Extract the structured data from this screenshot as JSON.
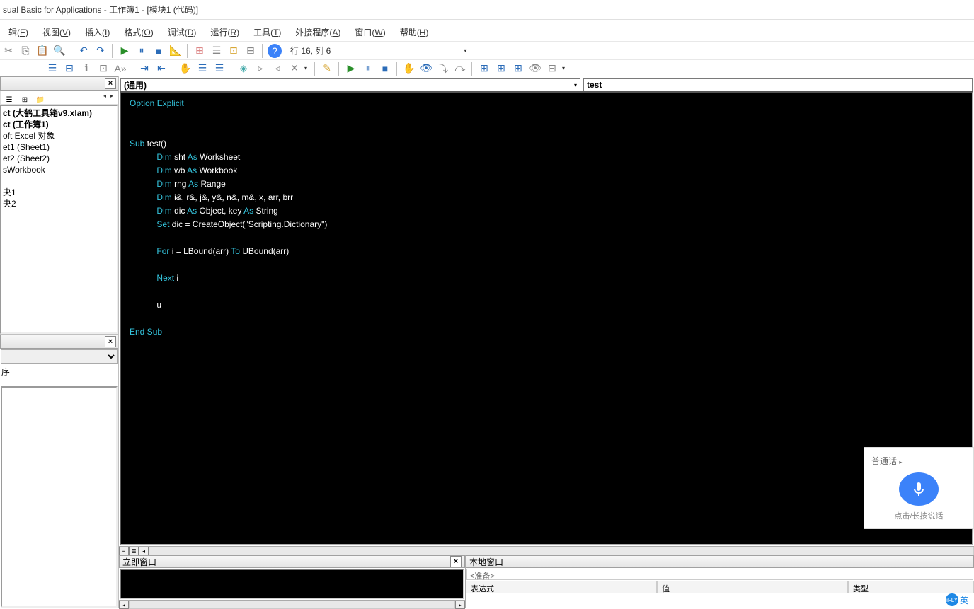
{
  "title": "sual Basic for Applications - 工作簿1 - [模块1 (代码)]",
  "menus": {
    "edit": {
      "label": "辑(E)",
      "key": "E"
    },
    "view": {
      "label": "视图(V)",
      "key": "V"
    },
    "insert": {
      "label": "插入(I)",
      "key": "I"
    },
    "format": {
      "label": "格式(O)",
      "key": "O"
    },
    "debug": {
      "label": "调试(D)",
      "key": "D"
    },
    "run": {
      "label": "运行(R)",
      "key": "R"
    },
    "tools": {
      "label": "工具(T)",
      "key": "T"
    },
    "addins": {
      "label": "外接程序(A)",
      "key": "A"
    },
    "window": {
      "label": "窗口(W)",
      "key": "W"
    },
    "help": {
      "label": "帮助(H)",
      "key": "H"
    }
  },
  "position_text": "行 16, 列 6",
  "project_tree": {
    "line1": "ct (大鹤工具箱v9.xlam)",
    "line2": "ct (工作簿1)",
    "line3": "oft Excel 对象",
    "line4": "et1 (Sheet1)",
    "line5": "et2 (Sheet2)",
    "line6": "sWorkbook",
    "line7": "夬1",
    "line8": "夬2"
  },
  "proc_title": "序",
  "dropdowns": {
    "object": "(通用)",
    "proc": "test"
  },
  "code_line_option": "Option Explicit",
  "code_sub": "Sub ",
  "code_test": "test",
  "code_paren": "()",
  "code_dim": "Dim ",
  "code_sht": "sht ",
  "code_as": "As ",
  "code_worksheet": "Worksheet",
  "code_wb": "wb ",
  "code_workbook": "Workbook",
  "code_rng": "rng ",
  "code_range": "Range",
  "code_vars": "i&, r&, j&, y&, n&, m&, x, arr, brr",
  "code_dic": "dic ",
  "code_object": "Object",
  "code_comma": ", ",
  "code_key": "key ",
  "code_string": "String",
  "code_set": "Set ",
  "code_dic2": "dic = ",
  "code_createobj": "CreateObject",
  "code_strlit": "(\"Scripting.Dictionary\")",
  "code_for": "For ",
  "code_i": "i = ",
  "code_lbound": "LBound",
  "code_arr1": "(arr) ",
  "code_to": "To ",
  "code_ubound": "UBound",
  "code_arr2": "(arr)",
  "code_next": "Next ",
  "code_ivar": "i",
  "code_u": "u",
  "code_endsub": "End Sub",
  "bottom": {
    "immediate_title": "立即窗口",
    "locals_title": "本地窗口",
    "ready": "<准备>",
    "col_expr": "表达式",
    "col_value": "值",
    "col_type": "类型"
  },
  "ime": {
    "title": "普通话",
    "hint": "点击/长按说话"
  },
  "tray_text": "英"
}
